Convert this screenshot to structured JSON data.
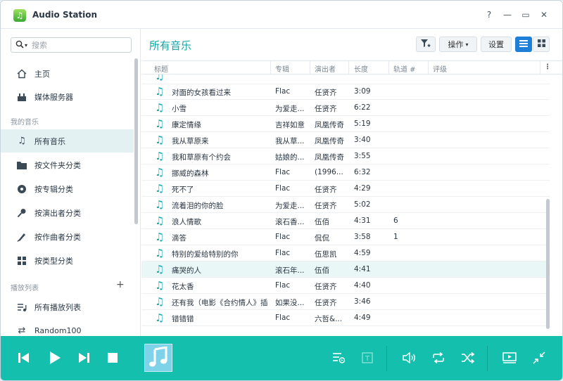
{
  "window": {
    "title": "Audio Station",
    "controls": [
      "?",
      "—",
      "▭",
      "✕"
    ]
  },
  "sidebar": {
    "search_placeholder": "搜索",
    "items_top": [
      {
        "label": "主页",
        "icon": "home-icon"
      },
      {
        "label": "媒体服务器",
        "icon": "media-server-icon"
      }
    ],
    "section_my_music": "我的音乐",
    "items_music": [
      {
        "label": "所有音乐",
        "icon": "music-note-icon",
        "active": true
      },
      {
        "label": "按文件夹分类",
        "icon": "folder-icon"
      },
      {
        "label": "按专辑分类",
        "icon": "album-icon"
      },
      {
        "label": "按演出者分类",
        "icon": "artist-icon"
      },
      {
        "label": "按作曲者分类",
        "icon": "composer-icon"
      },
      {
        "label": "按类型分类",
        "icon": "genre-icon"
      }
    ],
    "section_playlists": "播放列表",
    "items_playlists": [
      {
        "label": "所有播放列表",
        "icon": "playlist-icon"
      },
      {
        "label": "Random100",
        "icon": "shuffle-icon"
      }
    ]
  },
  "main": {
    "title": "所有音乐",
    "toolbar": {
      "filter_icon": "filter-icon",
      "actions_label": "操作",
      "settings_label": "设置",
      "list_view_icon": "list-view-icon",
      "grid_view_icon": "grid-view-icon"
    },
    "columns": [
      "标题",
      "专辑",
      "演出者",
      "长度",
      "轨道 #",
      "评级"
    ],
    "rows": [
      {
        "title": "对面的女孩看过来",
        "album": "Flac",
        "artist": "任贤齐",
        "length": "3:09",
        "track": ""
      },
      {
        "title": "小雪",
        "album": "为爱走...",
        "artist": "任贤齐",
        "length": "6:22",
        "track": ""
      },
      {
        "title": "康定情缘",
        "album": "吉祥如意",
        "artist": "凤凰传奇",
        "length": "5:19",
        "track": ""
      },
      {
        "title": "我从草原来",
        "album": "我从草...",
        "artist": "凤凰传奇",
        "length": "3:40",
        "track": ""
      },
      {
        "title": "我和草原有个约会",
        "album": "姑娘的...",
        "artist": "凤凰传奇",
        "length": "3:55",
        "track": ""
      },
      {
        "title": "挪威的森林",
        "album": "Flac",
        "artist": "(1996...",
        "length": "6:32",
        "track": ""
      },
      {
        "title": "死不了",
        "album": "Flac",
        "artist": "任贤齐",
        "length": "4:29",
        "track": ""
      },
      {
        "title": "流着泪的你的脸",
        "album": "为爱走...",
        "artist": "任贤齐",
        "length": "5:02",
        "track": ""
      },
      {
        "title": "浪人情歌",
        "album": "滚石香...",
        "artist": "伍佰",
        "length": "4:31",
        "track": "6"
      },
      {
        "title": "滴答",
        "album": "Flac",
        "artist": "侃侃",
        "length": "3:58",
        "track": "1"
      },
      {
        "title": "特别的爱给特别的你",
        "album": "Flac",
        "artist": "伍思凯",
        "length": "4:59",
        "track": ""
      },
      {
        "title": "痛哭的人",
        "album": "滚石年...",
        "artist": "伍佰",
        "length": "4:41",
        "track": "",
        "selected": true
      },
      {
        "title": "花太香",
        "album": "Flac",
        "artist": "任贤齐",
        "length": "4:40",
        "track": ""
      },
      {
        "title": "还有我（电影《合约情人》插曲）",
        "album": "如果没...",
        "artist": "任贤齐",
        "length": "3:46",
        "track": ""
      },
      {
        "title": "错错错",
        "album": "Flac",
        "artist": "六哲&...",
        "length": "4:49",
        "track": ""
      }
    ]
  },
  "player": {
    "controls": [
      "previous-icon",
      "play-icon",
      "next-icon",
      "stop-icon"
    ],
    "right_controls": [
      "queue-icon",
      "lyrics-icon",
      "volume-icon",
      "repeat-icon",
      "shuffle-icon",
      "mini-player-icon",
      "collapse-icon"
    ]
  },
  "colors": {
    "accent": "#14bfae",
    "title_teal": "#14a4a4",
    "active_nav": "#e3f1f3",
    "note_icon": "#16a8b4"
  }
}
